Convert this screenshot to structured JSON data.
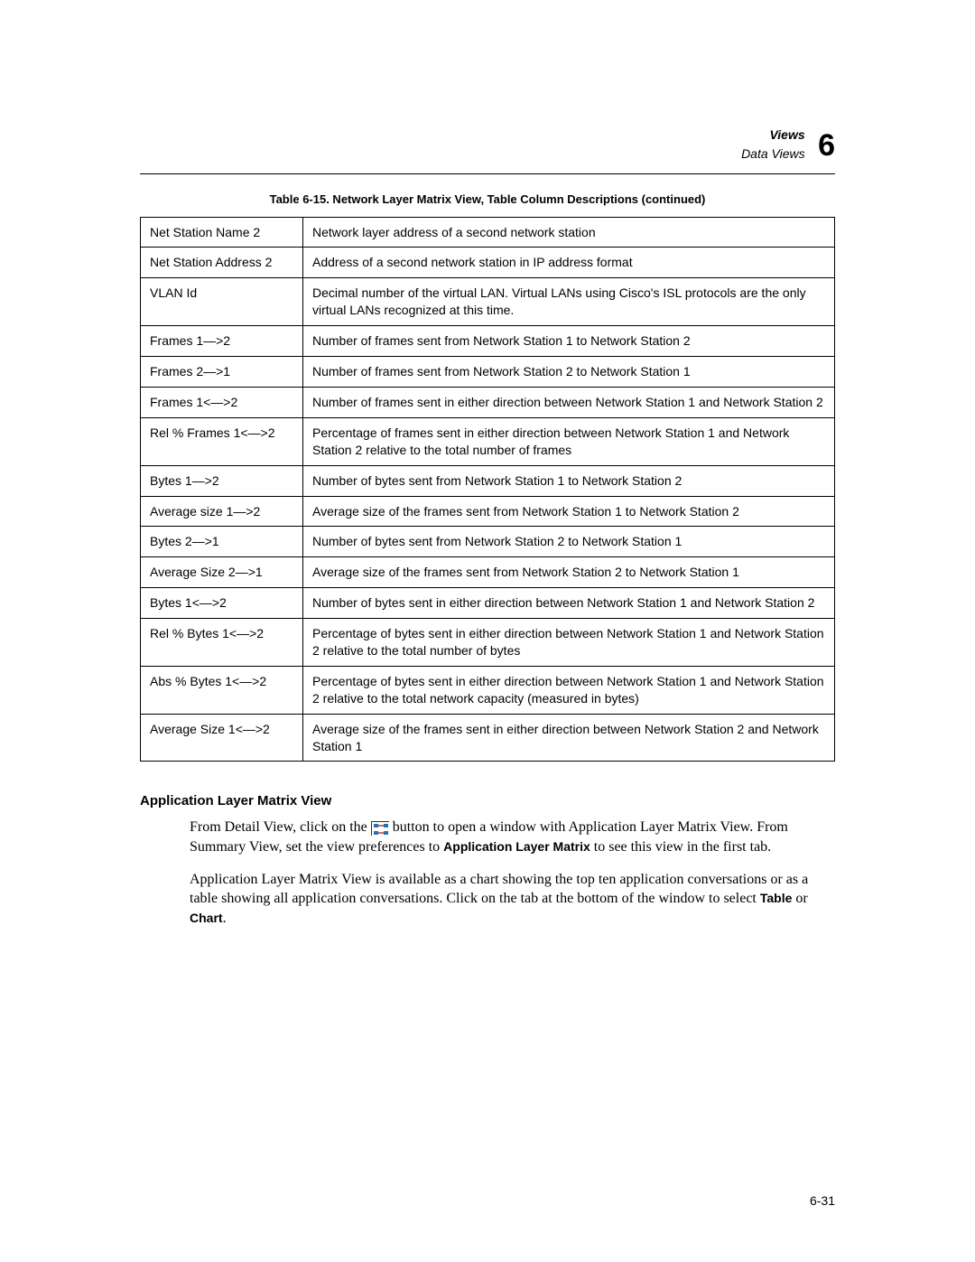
{
  "header": {
    "title": "Views",
    "subtitle": "Data Views",
    "chapter_number": "6"
  },
  "table": {
    "caption": "Table 6-15. Network Layer Matrix View, Table Column Descriptions (continued)",
    "rows": [
      {
        "label": "Net Station Name 2",
        "desc": "Network layer address of a second network station"
      },
      {
        "label": "Net Station Address 2",
        "desc": "Address of a second network station in IP address format"
      },
      {
        "label": "VLAN Id",
        "desc": "Decimal number of the virtual LAN. Virtual LANs using Cisco's ISL protocols are the only virtual LANs recognized at this time."
      },
      {
        "label": "Frames 1—>2",
        "desc": "Number of frames sent from Network Station 1 to Network Station 2"
      },
      {
        "label": "Frames 2—>1",
        "desc": "Number of frames sent from Network Station 2 to Network Station 1"
      },
      {
        "label": "Frames 1<—>2",
        "desc": "Number of frames sent in either direction between Network Station 1 and Network Station 2"
      },
      {
        "label": "Rel % Frames 1<—>2",
        "desc": "Percentage of frames sent in either direction between Network Station 1 and Network Station 2 relative to the total number of frames"
      },
      {
        "label": "Bytes 1—>2",
        "desc": "Number of bytes sent from Network Station 1 to Network Station 2"
      },
      {
        "label": "Average size 1—>2",
        "desc": "Average size of the frames sent from Network Station 1 to Network Station 2"
      },
      {
        "label": "Bytes 2—>1",
        "desc": "Number of bytes sent from Network Station 2 to Network Station 1"
      },
      {
        "label": "Average Size 2—>1",
        "desc": "Average size of the frames sent from Network Station 2 to Network Station 1"
      },
      {
        "label": "Bytes 1<—>2",
        "desc": "Number of bytes sent in either direction between Network Station 1 and Network Station 2"
      },
      {
        "label": "Rel % Bytes 1<—>2",
        "desc": "Percentage of bytes sent in either direction between Network Station 1 and Network Station 2 relative to the total number of bytes"
      },
      {
        "label": "Abs % Bytes 1<—>2",
        "desc": "Percentage of bytes sent in either direction between Network Station 1 and Network Station 2 relative to the total network capacity (measured in bytes)"
      },
      {
        "label": "Average Size 1<—>2",
        "desc": "Average size of the frames sent in either direction between Network Station 2 and Network Station 1"
      }
    ]
  },
  "section": {
    "heading": "Application Layer Matrix View",
    "para1_pre": "From Detail View, click on the ",
    "para1_post": " button to open a window with Application Layer Matrix View. From Summary View, set the view preferences to ",
    "para1_bold1": "Application Layer Matrix",
    "para1_tail": " to see this view in the first tab.",
    "para2_pre": "Application Layer Matrix View is available as a chart showing the top ten application conversations or as a table showing all application conversations. Click on the tab at the bottom of the window to select ",
    "para2_bold1": "Table",
    "para2_mid": " or ",
    "para2_bold2": "Chart",
    "para2_tail": "."
  },
  "footer": {
    "page_number": "6-31"
  }
}
